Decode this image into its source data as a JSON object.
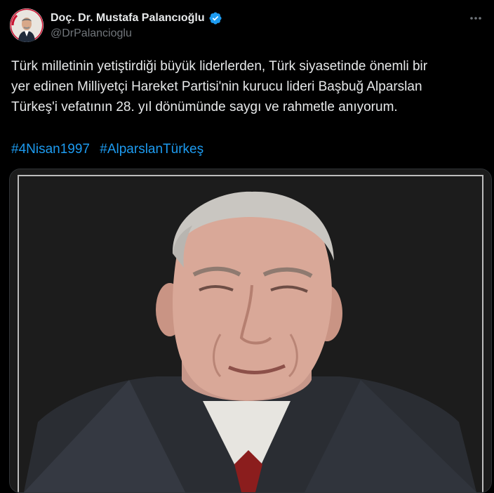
{
  "author": {
    "display_name": "Doç. Dr. Mustafa Palancıoğlu",
    "handle": "@DrPalancioglu",
    "verified": true
  },
  "tweet": {
    "lines": [
      "Türk milletinin yetiştirdiği büyük liderlerden, Türk siyasetinde önemli bir",
      "yer edinen Milliyetçi Hareket Partisi'nin kurucu lideri Başbuğ Alparslan",
      "Türkeş'i vefatının 28. yıl dönümünde saygı ve rahmetle anıyorum."
    ],
    "hashtags": [
      "#4Nisan1997",
      "#AlparslanTürkeş"
    ]
  },
  "icons": {
    "verified": "verified-badge-icon",
    "more": "more-dots-icon"
  },
  "colors": {
    "background": "#000000",
    "text": "#e7e9ea",
    "secondary_text": "#71767b",
    "link": "#1d9bf0",
    "verified": "#1d9bf0",
    "card_border": "#2f3336"
  }
}
